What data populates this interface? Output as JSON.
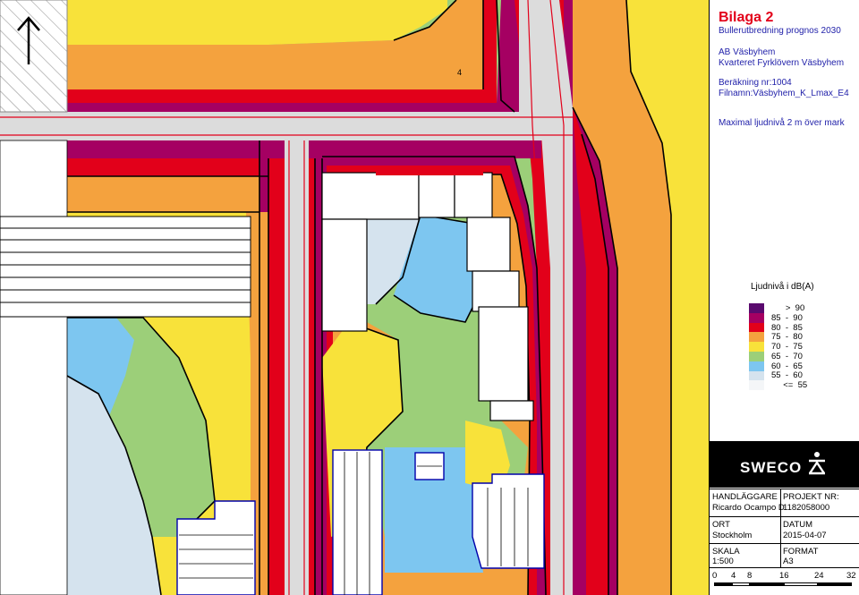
{
  "title": "Bilaga 2",
  "subtitle": "Bullerutbredning prognos 2030",
  "client": "AB Väsbyhem",
  "project_name": "Kvarteret Fyrklövern Väsbyhem",
  "calc_number": "Beräkning nr:1004",
  "filename": "Filnamn:Väsbyhem_K_Lmax_E4",
  "description": "Maximal ljudnivå 2 m över mark",
  "legend": {
    "title": "Ljudnivå i dB(A)",
    "items": [
      {
        "label": "      >  90",
        "color": "#5a0a6e"
      },
      {
        "label": "85  -  90",
        "color": "#a50062"
      },
      {
        "label": "80  -  85",
        "color": "#e2001a"
      },
      {
        "label": "75  -  80",
        "color": "#f4a23e"
      },
      {
        "label": "70  -  75",
        "color": "#f8e23a"
      },
      {
        "label": "65  -  70",
        "color": "#9ccf79"
      },
      {
        "label": "60  -  65",
        "color": "#7dc6f0"
      },
      {
        "label": "55  -  60",
        "color": "#d5e3ee"
      },
      {
        "label": "     <=  55",
        "color": "#f4f6f8"
      }
    ]
  },
  "logo": "SWECO",
  "info": {
    "handlaggare_label": "HANDLÄGGARE",
    "handlaggare": "Ricardo Ocampo D.",
    "projekt_label": "PROJEKT NR:",
    "projekt": "1182058000",
    "ort_label": "ORT",
    "ort": "Stockholm",
    "datum_label": "DATUM",
    "datum": "2015-04-07",
    "skala_label": "SKALA",
    "skala": "1:500",
    "format_label": "FORMAT",
    "format": "A3"
  },
  "scale_bar": [
    "0",
    "4",
    "8",
    "16",
    "24",
    "32"
  ],
  "map_label": "4",
  "colors": {
    "z90": "#5a0a6e",
    "z85": "#a50062",
    "z80": "#e2001a",
    "z75": "#f4a23e",
    "z70": "#f8e23a",
    "z65": "#9ccf79",
    "z60": "#7dc6f0",
    "z55": "#d5e3ee",
    "road": "#dcdcdc",
    "title_red": "#e2001a",
    "text_blue": "#2222aa",
    "building_outline": "#0000aa"
  }
}
